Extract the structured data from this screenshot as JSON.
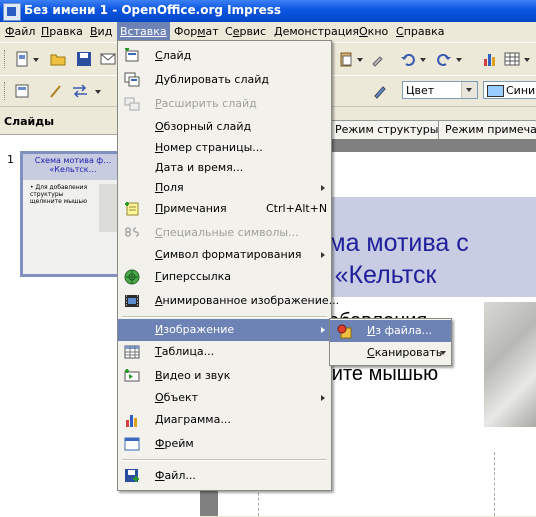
{
  "window": {
    "title": "Без имени 1 - OpenOffice.org Impress"
  },
  "menubar": {
    "items": [
      {
        "pre": "",
        "u": "Ф",
        "post": "айл"
      },
      {
        "pre": "",
        "u": "П",
        "post": "равка"
      },
      {
        "pre": "",
        "u": "В",
        "post": "ид"
      },
      {
        "pre": "Вс",
        "u": "т",
        "post": "авка"
      },
      {
        "pre": "Фор",
        "u": "м",
        "post": "ат"
      },
      {
        "pre": "С",
        "u": "е",
        "post": "рвис"
      },
      {
        "pre": "",
        "u": "Д",
        "post": "емонстрация"
      },
      {
        "pre": "",
        "u": "О",
        "post": "кно"
      },
      {
        "pre": "",
        "u": "С",
        "post": "правка"
      }
    ],
    "active_index": 3
  },
  "toolbar2": {
    "color_mode": "Цвет",
    "line_color": "Синий"
  },
  "slides_panel": {
    "title": "Слайды",
    "slide_number": "1"
  },
  "thumbnail": {
    "title": "Схема мотива ф… «Кельтск…",
    "body": "• Для добавления структуры щелкните мышью"
  },
  "view_tabs": {
    "outline": "Режим структуры",
    "notes": "Режим примечани"
  },
  "slide": {
    "title_line1": "хема мотива с",
    "title_line2": "«Кельтск",
    "body_line1": "обавления",
    "body_line2": "кните мышью"
  },
  "insert_menu": {
    "items": [
      {
        "label": "Слайд",
        "u": "С",
        "icon": "new-slide-icon",
        "enabled": true
      },
      {
        "label": "Дублировать слайд",
        "u": "Д",
        "icon": "duplicate-slide-icon",
        "enabled": true
      },
      {
        "label": "Расширить слайд",
        "u": "Р",
        "icon": "expand-slide-icon",
        "enabled": false
      },
      {
        "label": "Обзорный слайд",
        "u": "О",
        "icon": null,
        "enabled": true
      },
      {
        "label": "Номер страницы...",
        "u": "Н",
        "icon": null,
        "enabled": true
      },
      {
        "label": "Дата и время...",
        "u": "Д",
        "icon": null,
        "enabled": true
      },
      {
        "label": "Поля",
        "u": "П",
        "icon": null,
        "enabled": true,
        "submenu": true
      },
      {
        "label": "Примечания",
        "u": "П",
        "icon": "note-icon",
        "enabled": true,
        "shortcut": "Ctrl+Alt+N"
      },
      {
        "label": "Специальные символы...",
        "u": "С",
        "icon": "special-chars-icon",
        "enabled": false
      },
      {
        "label": "Символ форматирования",
        "u": "С",
        "icon": null,
        "enabled": true,
        "submenu": true
      },
      {
        "label": "Гиперссылка",
        "u": "Г",
        "icon": "hyperlink-icon",
        "enabled": true
      },
      {
        "label": "Анимированное изображение...",
        "u": "А",
        "icon": "animated-image-icon",
        "enabled": true
      },
      {
        "label": "Изображение",
        "u": "И",
        "icon": null,
        "enabled": true,
        "submenu": true,
        "highlighted": true
      },
      {
        "label": "Таблица...",
        "u": "Т",
        "icon": "table-icon",
        "enabled": true
      },
      {
        "label": "Видео и звук",
        "u": "В",
        "icon": "video-sound-icon",
        "enabled": true
      },
      {
        "label": "Объект",
        "u": "О",
        "icon": null,
        "enabled": true,
        "submenu": true
      },
      {
        "label": "Диаграмма...",
        "u": "Д",
        "icon": "chart-icon",
        "enabled": true
      },
      {
        "label": "Фрейм",
        "u": "Ф",
        "icon": "frame-icon",
        "enabled": true
      },
      {
        "label": "Файл...",
        "u": "Ф",
        "icon": "file-icon",
        "enabled": true
      }
    ]
  },
  "image_submenu": {
    "items": [
      {
        "label": "Из файла...",
        "u": "И",
        "icon": "from-file-icon",
        "highlighted": true
      },
      {
        "label": "Сканировать",
        "u": "С",
        "submenu": true
      }
    ]
  }
}
